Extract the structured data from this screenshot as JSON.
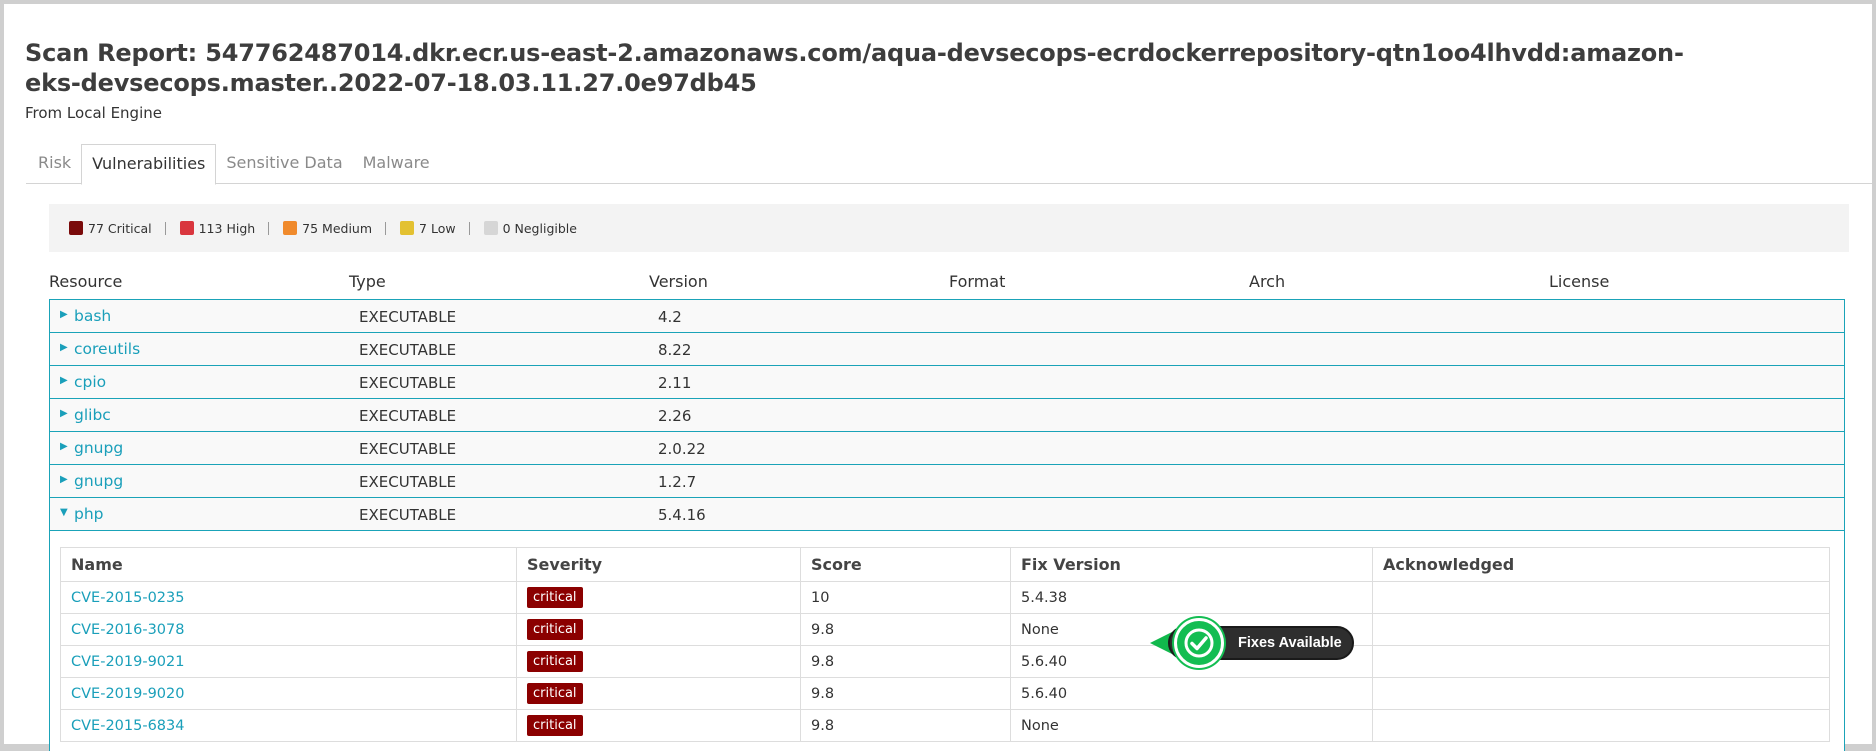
{
  "header": {
    "title": "Scan Report: 547762487014.dkr.ecr.us-east-2.amazonaws.com/aqua-devsecops-ecrdockerrepository-qtn1oo4lhvdd:amazon-eks-devsecops.master..2022-07-18.03.11.27.0e97db45",
    "subtitle": "From Local Engine"
  },
  "tabs": [
    {
      "label": "Risk",
      "active": false
    },
    {
      "label": "Vulnerabilities",
      "active": true
    },
    {
      "label": "Sensitive Data",
      "active": false
    },
    {
      "label": "Malware",
      "active": false
    }
  ],
  "summary": [
    {
      "label": "77 Critical",
      "color": "#7a0a0a"
    },
    {
      "label": "113 High",
      "color": "#d9363e"
    },
    {
      "label": "75 Medium",
      "color": "#f08a2c"
    },
    {
      "label": "7 Low",
      "color": "#e3c131"
    },
    {
      "label": "0 Negligible",
      "color": "#d6d6d6"
    }
  ],
  "columns": [
    "Resource",
    "Type",
    "Version",
    "Format",
    "Arch",
    "License"
  ],
  "packages": [
    {
      "name": "bash",
      "type": "EXECUTABLE",
      "version": "4.2",
      "expanded": false
    },
    {
      "name": "coreutils",
      "type": "EXECUTABLE",
      "version": "8.22",
      "expanded": false
    },
    {
      "name": "cpio",
      "type": "EXECUTABLE",
      "version": "2.11",
      "expanded": false
    },
    {
      "name": "glibc",
      "type": "EXECUTABLE",
      "version": "2.26",
      "expanded": false
    },
    {
      "name": "gnupg",
      "type": "EXECUTABLE",
      "version": "2.0.22",
      "expanded": false
    },
    {
      "name": "gnupg",
      "type": "EXECUTABLE",
      "version": "1.2.7",
      "expanded": false
    },
    {
      "name": "php",
      "type": "EXECUTABLE",
      "version": "5.4.16",
      "expanded": true
    }
  ],
  "vuln_columns": [
    "Name",
    "Severity",
    "Score",
    "Fix Version",
    "Acknowledged"
  ],
  "vulns": [
    {
      "name": "CVE-2015-0235",
      "severity": "critical",
      "score": "10",
      "fix": "5.4.38",
      "ack": ""
    },
    {
      "name": "CVE-2016-3078",
      "severity": "critical",
      "score": "9.8",
      "fix": "None",
      "ack": ""
    },
    {
      "name": "CVE-2019-9021",
      "severity": "critical",
      "score": "9.8",
      "fix": "5.6.40",
      "ack": ""
    },
    {
      "name": "CVE-2019-9020",
      "severity": "critical",
      "score": "9.8",
      "fix": "5.6.40",
      "ack": ""
    },
    {
      "name": "CVE-2015-6834",
      "severity": "critical",
      "score": "9.8",
      "fix": "None",
      "ack": ""
    }
  ],
  "overlay": {
    "label": "Fixes Available",
    "icon": "check-circle-icon",
    "color": "#13bd52"
  }
}
